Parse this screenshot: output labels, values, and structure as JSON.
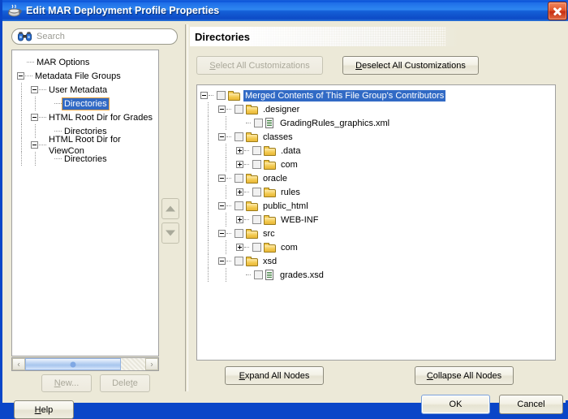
{
  "window": {
    "title": "Edit MAR Deployment Profile Properties",
    "title_icon": "coffee-cup-icon",
    "close_label": "Close"
  },
  "search": {
    "placeholder": "Search",
    "value": "",
    "icon": "binoculars-icon"
  },
  "nav_tree": {
    "items": [
      {
        "label": "MAR Options",
        "indent": 0,
        "toggle": "none",
        "selected": false
      },
      {
        "label": "Metadata File Groups",
        "indent": 0,
        "toggle": "minus",
        "selected": false
      },
      {
        "label": "User Metadata",
        "indent": 1,
        "toggle": "minus",
        "selected": false
      },
      {
        "label": "Directories",
        "indent": 2,
        "toggle": "none",
        "selected": true
      },
      {
        "label": "HTML Root Dir for Grades",
        "indent": 1,
        "toggle": "minus",
        "selected": false
      },
      {
        "label": "Directories",
        "indent": 2,
        "toggle": "none",
        "selected": false
      },
      {
        "label": "HTML Root Dir for ViewCon",
        "indent": 1,
        "toggle": "minus",
        "selected": false
      },
      {
        "label": "Directories",
        "indent": 2,
        "toggle": "none",
        "selected": false
      }
    ]
  },
  "nav_scrollbar": {
    "left_arrow": "‹",
    "right_arrow": "›"
  },
  "reorder": {
    "up_icon": "arrow-up-icon",
    "down_icon": "arrow-down-icon"
  },
  "left_buttons": [
    {
      "label": "New...",
      "underline_index": 0,
      "disabled": true
    },
    {
      "label": "Delete",
      "underline_index": 4,
      "disabled": true
    }
  ],
  "help_button": {
    "label": "Help",
    "underline_index": 0,
    "disabled": false
  },
  "section": {
    "title": "Directories"
  },
  "customization_buttons": [
    {
      "label": "Select All Customizations",
      "underline_index": 0,
      "disabled": true
    },
    {
      "label": "Deselect All Customizations",
      "underline_index": 0,
      "disabled": false
    }
  ],
  "file_tree": {
    "nodes": [
      {
        "label": "Merged Contents of This File Group's Contributors",
        "depth": 0,
        "toggle": "minus",
        "checked": false,
        "icon": "folder-icon",
        "selected": true
      },
      {
        "label": ".designer",
        "depth": 1,
        "toggle": "minus",
        "checked": false,
        "icon": "folder-icon",
        "selected": false
      },
      {
        "label": "GradingRules_graphics.xml",
        "depth": 2,
        "toggle": "none",
        "checked": false,
        "icon": "file-icon",
        "selected": false
      },
      {
        "label": "classes",
        "depth": 1,
        "toggle": "minus",
        "checked": false,
        "icon": "folder-icon",
        "selected": false
      },
      {
        "label": ".data",
        "depth": 2,
        "toggle": "plus",
        "checked": false,
        "icon": "folder-icon",
        "selected": false
      },
      {
        "label": "com",
        "depth": 2,
        "toggle": "plus",
        "checked": false,
        "icon": "folder-icon",
        "selected": false
      },
      {
        "label": "oracle",
        "depth": 1,
        "toggle": "minus",
        "checked": false,
        "icon": "folder-icon",
        "selected": false
      },
      {
        "label": "rules",
        "depth": 2,
        "toggle": "plus",
        "checked": false,
        "icon": "folder-icon",
        "selected": false
      },
      {
        "label": "public_html",
        "depth": 1,
        "toggle": "minus",
        "checked": false,
        "icon": "folder-icon",
        "selected": false
      },
      {
        "label": "WEB-INF",
        "depth": 2,
        "toggle": "plus",
        "checked": false,
        "icon": "folder-icon",
        "selected": false
      },
      {
        "label": "src",
        "depth": 1,
        "toggle": "minus",
        "checked": false,
        "icon": "folder-icon",
        "selected": false
      },
      {
        "label": "com",
        "depth": 2,
        "toggle": "plus",
        "checked": false,
        "icon": "folder-icon",
        "selected": false
      },
      {
        "label": "xsd",
        "depth": 1,
        "toggle": "minus",
        "checked": false,
        "icon": "folder-icon",
        "selected": false
      },
      {
        "label": "grades.xsd",
        "depth": 2,
        "toggle": "none",
        "checked": false,
        "icon": "file-icon",
        "selected": false
      }
    ]
  },
  "node_buttons": [
    {
      "label": "Expand All Nodes",
      "underline_index": 0,
      "disabled": false
    },
    {
      "label": "Collapse All Nodes",
      "underline_index": 0,
      "disabled": false
    }
  ],
  "dialog_buttons": [
    {
      "label": "OK",
      "default": true,
      "disabled": false
    },
    {
      "label": "Cancel",
      "default": false,
      "disabled": false
    }
  ],
  "colors": {
    "titlebar_blue": "#0a52d8",
    "selection_blue": "#316ac5",
    "dialog_face": "#ece9d8",
    "folder_yellow": "#f2c84b",
    "close_red": "#c62e12"
  }
}
